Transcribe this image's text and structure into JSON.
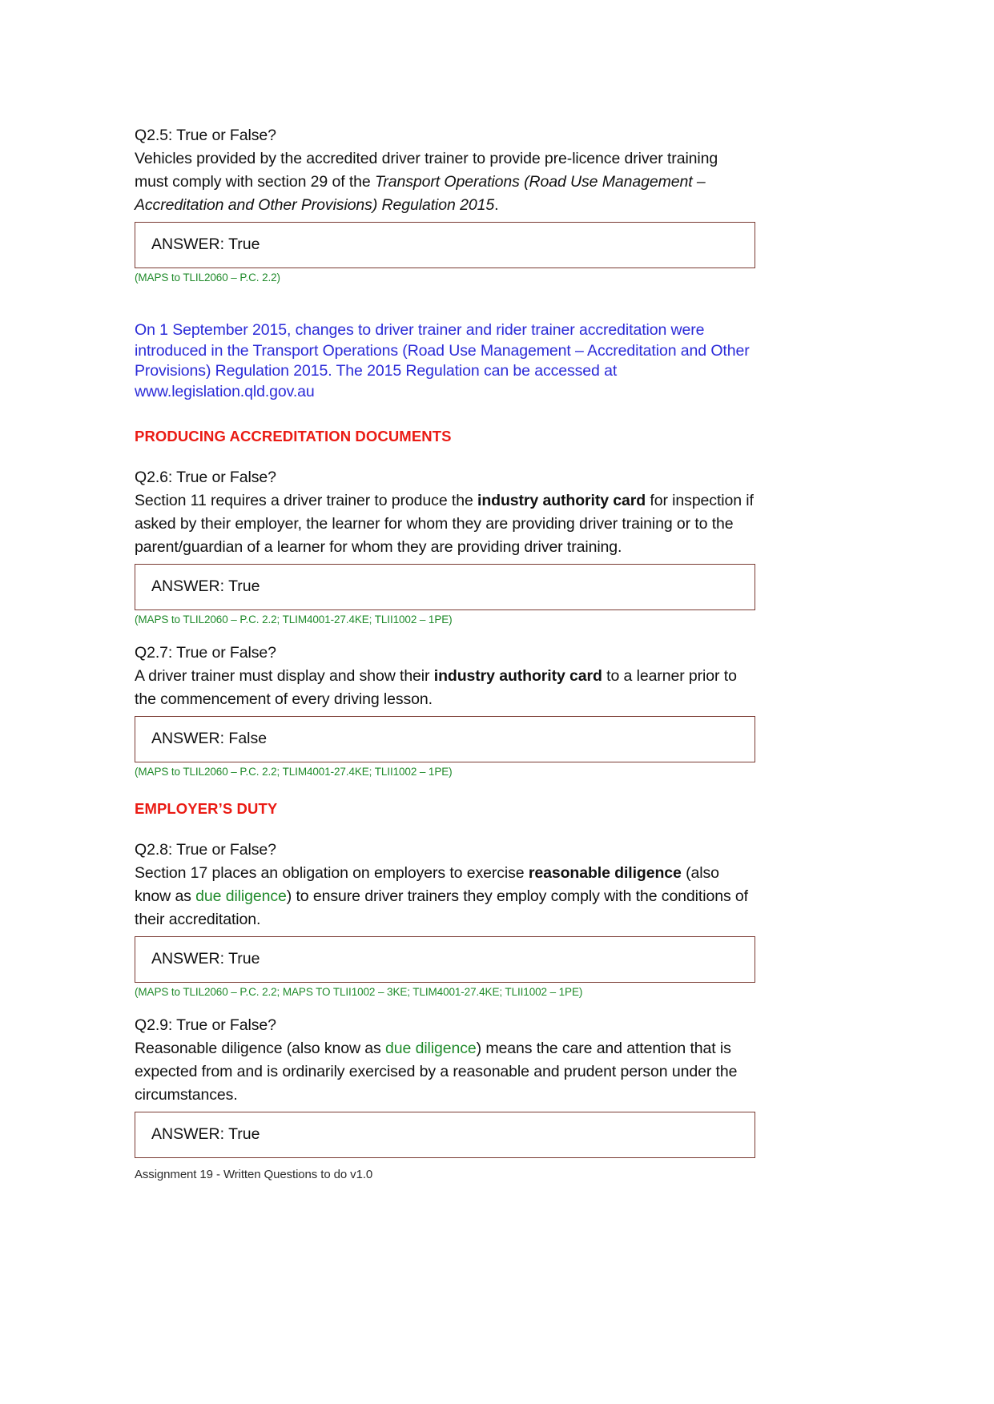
{
  "document": {
    "footer": "Assignment 19 - Written Questions to do v1.0"
  },
  "colors": {
    "text": "#111111",
    "citation_green": "#1f8a2a",
    "info_blue": "#2b2bd8",
    "heading_red": "#ea1b14",
    "box_border": "#7a3b33"
  },
  "questions": [
    {
      "id": "q2-5",
      "prompt": "Q2.5: True or False?",
      "statement_part1": "Vehicles provided by the accredited driver trainer to provide pre-licence driver training must comply with section 29 of the ",
      "statement_italic": "Transport Operations (Road Use Management – Accreditation and Other Provisions) Regulation 2015",
      "statement_part2": ".",
      "answer_label": "ANSWER: True",
      "citation": "(MAPS to TLIL2060 – P.C. 2.2)"
    },
    {
      "id": "q2-6",
      "prompt": "Q2.6: True or False?",
      "statement_part1": "Section 11 requires a driver trainer to produce the ",
      "statement_bold": "industry authority card",
      "statement_part2": " for inspection if asked by their employer, the learner for whom they are providing driver training or to the parent/guardian of a learner for whom they are providing driver training.",
      "answer_label": "ANSWER: True",
      "citation": "(MAPS to TLIL2060 – P.C. 2.2; TLIM4001-27.4KE; TLII1002 – 1PE)"
    },
    {
      "id": "q2-7",
      "prompt": "Q2.7: True or False?",
      "statement_part1": "A driver trainer must display and show their ",
      "statement_bold": "industry authority card",
      "statement_part2": " to a learner prior to the commencement of every driving lesson.",
      "answer_label": "ANSWER: False",
      "citation": "(MAPS to TLIL2060 – P.C. 2.2; TLIM4001-27.4KE; TLII1002 – 1PE)"
    },
    {
      "id": "q2-8",
      "prompt": "Q2.8: True or False?",
      "statement_part1": "Section 17 places an obligation on employers to exercise ",
      "statement_bold": "reasonable diligence",
      "statement_part2": " (also know as ",
      "statement_green": "due diligence",
      "statement_part3": ") to ensure driver trainers they employ comply with the conditions of their accreditation.",
      "answer_label": "ANSWER: True",
      "citation": "(MAPS to TLIL2060 – P.C. 2.2; MAPS TO TLII1002 – 3KE; TLIM4001-27.4KE; TLII1002 – 1PE)"
    },
    {
      "id": "q2-9",
      "prompt": "Q2.9: True or False?",
      "statement_part1": "Reasonable diligence (also know as ",
      "statement_green": "due diligence",
      "statement_part2": ") means the care and attention that is expected from and is ordinarily exercised by a reasonable and prudent person under the circumstances.",
      "answer_label": "ANSWER: True"
    }
  ],
  "info_note": {
    "line1": "On 1 September 2015, changes to driver trainer and rider trainer accreditation were",
    "line2": "introduced in the Transport Operations (Road Use Management – Accreditation and Other",
    "line3": "Provisions) Regulation 2015. The 2015 Regulation can be accessed at",
    "line4": "www.legislation.qld.gov.au"
  },
  "headings": {
    "producing_accreditation_documents": "PRODUCING ACCREDITATION DOCUMENTS",
    "employers_duty": "EMPLOYER’S DUTY"
  }
}
